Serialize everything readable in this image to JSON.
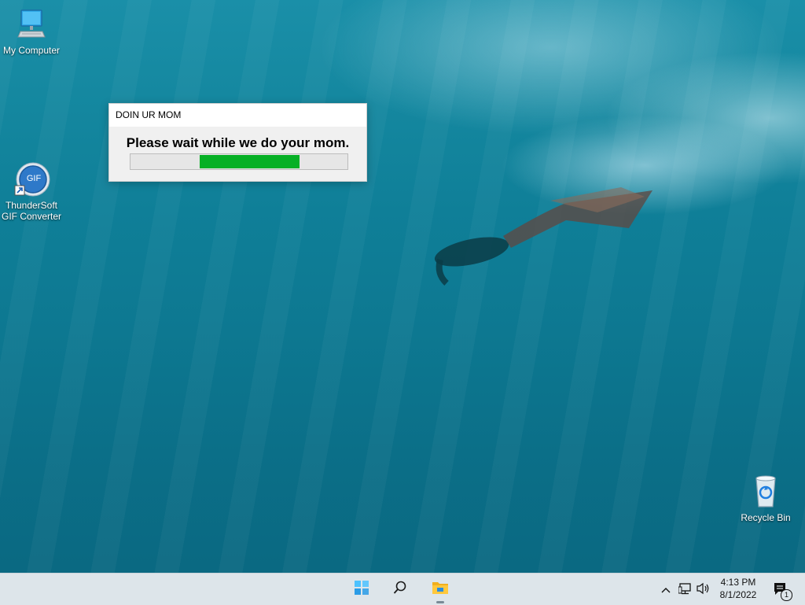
{
  "desktop": {
    "icons": [
      {
        "label": "My Computer",
        "icon": "monitor-icon"
      },
      {
        "label": "ThunderSoft GIF Converter",
        "line1": "ThunderSoft",
        "line2": "GIF Converter",
        "icon": "gif-converter-icon",
        "badge": "GIF"
      },
      {
        "label": "Recycle Bin",
        "icon": "recycle-bin-icon"
      }
    ]
  },
  "dialog": {
    "title": "DOIN UR MOM",
    "message": "Please wait while we do your mom.",
    "progress": {
      "start_fraction": 0.32,
      "end_fraction": 0.78,
      "color": "#06b025"
    }
  },
  "taskbar": {
    "buttons": [
      {
        "name": "start",
        "icon": "windows-start-icon"
      },
      {
        "name": "search",
        "icon": "search-icon"
      },
      {
        "name": "file-explorer",
        "icon": "folder-icon"
      }
    ],
    "tray": {
      "icons": [
        "chevron-up-icon",
        "network-icon",
        "volume-icon"
      ],
      "time": "4:13 PM",
      "date": "8/1/2022",
      "notifications": {
        "icon": "notification-icon",
        "count": "1"
      }
    }
  }
}
